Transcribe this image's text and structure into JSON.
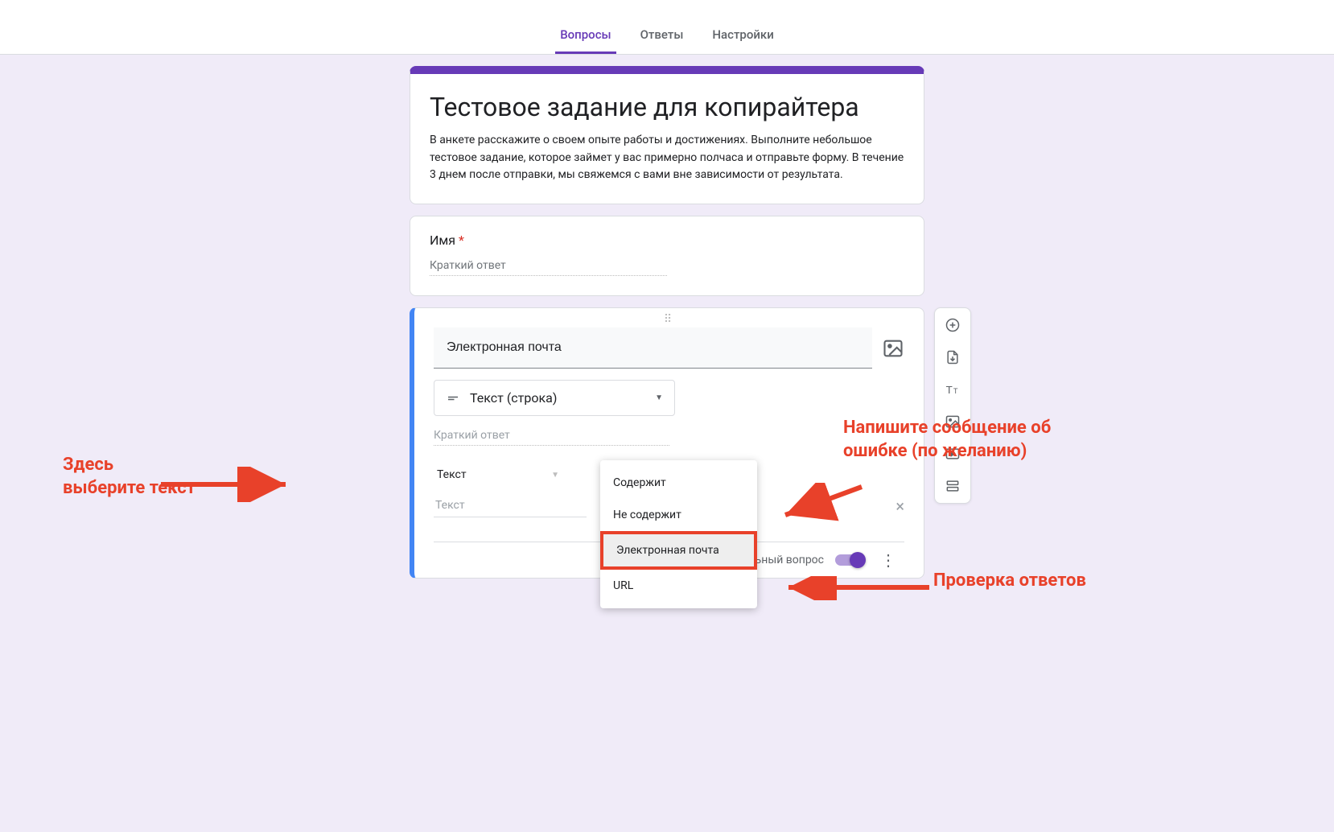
{
  "tabs": {
    "questions": "Вопросы",
    "answers": "Ответы",
    "settings": "Настройки"
  },
  "header": {
    "title": "Тестовое задание для копирайтера",
    "description": "В анкете расскажите о своем опыте работы и достижениях. Выполните небольшое тестовое задание, которое займет у вас примерно полчаса и отправьте форму. В течение 3 днем после отправки, мы свяжемся с вами вне зависимости от результата."
  },
  "question1": {
    "label": "Имя",
    "required_mark": "*",
    "placeholder": "Краткий ответ"
  },
  "active_question": {
    "title_value": "Электронная почта",
    "type_label": "Текст (строка)",
    "short_answer_placeholder": "Краткий ответ",
    "validation_type": "Текст",
    "text_field_placeholder": "Текст",
    "dropdown": {
      "opt1": "Содержит",
      "opt2": "Не содержит",
      "opt3": "Электронная почта",
      "opt4": "URL"
    },
    "footer_toggle_label": "тельный вопрос"
  },
  "annotations": {
    "left": "Здесь выберите текст",
    "right_top": "Напишите сообщение об ошибке (по желанию)",
    "right_bottom": "Проверка ответов"
  }
}
